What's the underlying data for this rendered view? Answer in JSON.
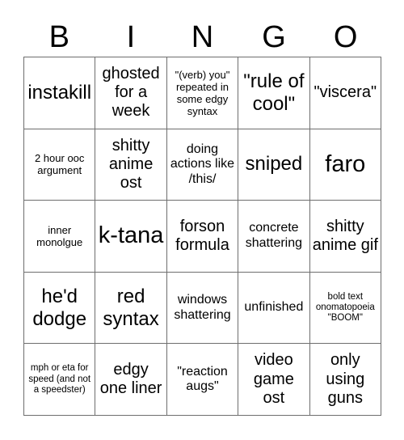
{
  "card": {
    "title_letters": [
      "B",
      "I",
      "N",
      "G",
      "O"
    ],
    "columns": 5,
    "rows": 5,
    "colors": {
      "background": "#ffffff",
      "text": "#000000",
      "grid_line": "#6e6e6e"
    },
    "cells": [
      {
        "text": "instakill",
        "size": "lg"
      },
      {
        "text": "ghosted for a week",
        "size": "md"
      },
      {
        "text": "\"(verb) you\" repeated in some edgy syntax",
        "size": "xs"
      },
      {
        "text": "\"rule of cool\"",
        "size": "lg"
      },
      {
        "text": "\"viscera\"",
        "size": "md"
      },
      {
        "text": "2 hour ooc argument",
        "size": "xs"
      },
      {
        "text": "shitty anime ost",
        "size": "md"
      },
      {
        "text": "doing actions like /this/",
        "size": "sm"
      },
      {
        "text": "sniped",
        "size": "lg"
      },
      {
        "text": "faro",
        "size": "xl"
      },
      {
        "text": "inner monolgue",
        "size": "xs"
      },
      {
        "text": "k-tana",
        "size": "xl"
      },
      {
        "text": "forson formula",
        "size": "md"
      },
      {
        "text": "concrete shattering",
        "size": "sm"
      },
      {
        "text": "shitty anime gif",
        "size": "md"
      },
      {
        "text": "he'd dodge",
        "size": "lg"
      },
      {
        "text": "red syntax",
        "size": "lg"
      },
      {
        "text": "windows shattering",
        "size": "sm"
      },
      {
        "text": "unfinished",
        "size": "sm"
      },
      {
        "text": "bold text onomatopoeia \"BOOM\"",
        "size": "xxs"
      },
      {
        "text": "mph or eta for speed (and not a speedster)",
        "size": "xxs"
      },
      {
        "text": "edgy one liner",
        "size": "md"
      },
      {
        "text": "\"reaction augs\"",
        "size": "sm"
      },
      {
        "text": "video game ost",
        "size": "md"
      },
      {
        "text": "only using guns",
        "size": "md"
      }
    ]
  }
}
